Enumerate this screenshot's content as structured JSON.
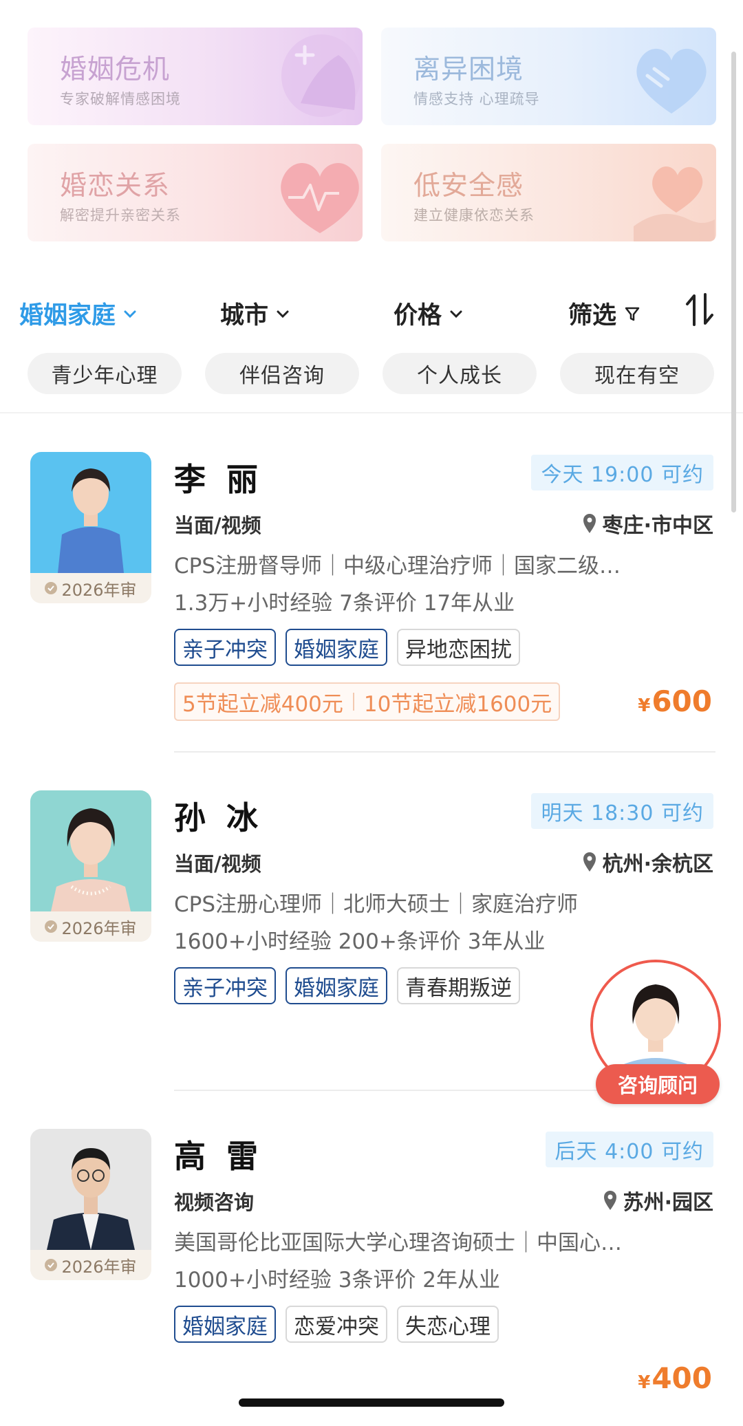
{
  "categories": [
    {
      "title": "婚姻危机",
      "subtitle": "专家破解情感困境"
    },
    {
      "title": "离异困境",
      "subtitle": "情感支持 心理疏导"
    },
    {
      "title": "婚恋关系",
      "subtitle": "解密提升亲密关系"
    },
    {
      "title": "低安全感",
      "subtitle": "建立健康依恋关系"
    }
  ],
  "filters": {
    "category": "婚姻家庭",
    "city": "城市",
    "price": "价格",
    "screen": "筛选",
    "active_color": "#2f9be7"
  },
  "chips": [
    "青少年心理",
    "伴侣咨询",
    "个人成长",
    "现在有空"
  ],
  "counselors": [
    {
      "name": "李丽",
      "badge": "2026年审",
      "availability": "今天 19:00 可约",
      "mode": "当面/视频",
      "location": "枣庄·市中区",
      "qualifications": "CPS注册督导师｜中级心理治疗师｜国家二级…",
      "stats": "1.3万+小时经验   7条评价   17年从业",
      "tags": [
        "亲子冲突",
        "婚姻家庭",
        "异地恋困扰"
      ],
      "promo1": "5节起立减400元",
      "promo2": "10节起立减1600元",
      "currency": "¥",
      "price": "600"
    },
    {
      "name": "孙冰",
      "badge": "2026年审",
      "availability": "明天 18:30 可约",
      "mode": "当面/视频",
      "location": "杭州·余杭区",
      "qualifications": "CPS注册心理师｜北师大硕士｜家庭治疗师",
      "stats": "1600+小时经验   200+条评价   3年从业",
      "tags": [
        "亲子冲突",
        "婚姻家庭",
        "青春期叛逆"
      ]
    },
    {
      "name": "高雷",
      "badge": "2026年审",
      "availability": "后天 4:00 可约",
      "mode": "视频咨询",
      "location": "苏州·园区",
      "qualifications": "美国哥伦比亚国际大学心理咨询硕士｜中国心…",
      "stats": "1000+小时经验   3条评价   2年从业",
      "tags": [
        "婚姻家庭",
        "恋爱冲突",
        "失恋心理"
      ],
      "currency": "¥",
      "price": "400"
    }
  ],
  "consultant": {
    "label": "咨询顾问"
  },
  "colors": {
    "price": "#ef7c2c",
    "availability_bg": "#eaf5fd",
    "consultant": "#ec5b4f"
  }
}
